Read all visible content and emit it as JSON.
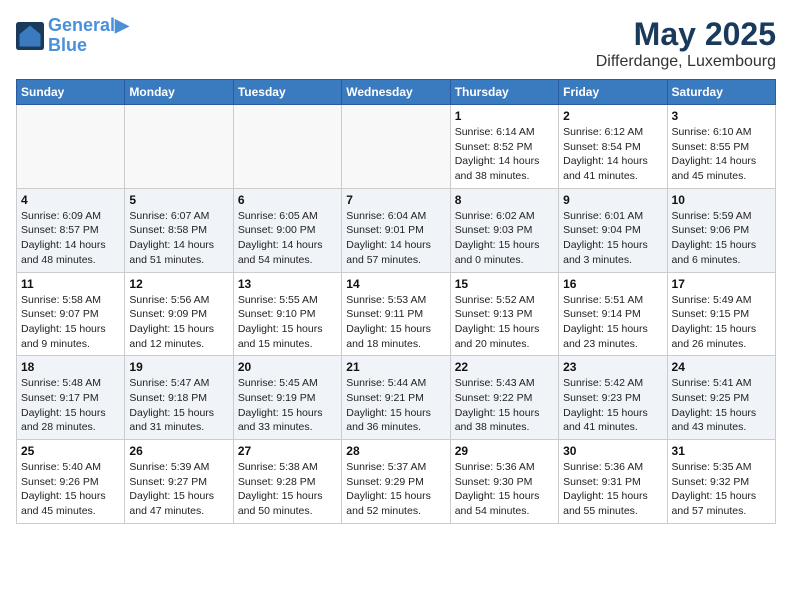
{
  "logo": {
    "line1": "General",
    "line2": "Blue"
  },
  "title": "May 2025",
  "subtitle": "Differdange, Luxembourg",
  "weekdays": [
    "Sunday",
    "Monday",
    "Tuesday",
    "Wednesday",
    "Thursday",
    "Friday",
    "Saturday"
  ],
  "weeks": [
    [
      {
        "day": "",
        "info": ""
      },
      {
        "day": "",
        "info": ""
      },
      {
        "day": "",
        "info": ""
      },
      {
        "day": "",
        "info": ""
      },
      {
        "day": "1",
        "info": "Sunrise: 6:14 AM\nSunset: 8:52 PM\nDaylight: 14 hours and 38 minutes."
      },
      {
        "day": "2",
        "info": "Sunrise: 6:12 AM\nSunset: 8:54 PM\nDaylight: 14 hours and 41 minutes."
      },
      {
        "day": "3",
        "info": "Sunrise: 6:10 AM\nSunset: 8:55 PM\nDaylight: 14 hours and 45 minutes."
      }
    ],
    [
      {
        "day": "4",
        "info": "Sunrise: 6:09 AM\nSunset: 8:57 PM\nDaylight: 14 hours and 48 minutes."
      },
      {
        "day": "5",
        "info": "Sunrise: 6:07 AM\nSunset: 8:58 PM\nDaylight: 14 hours and 51 minutes."
      },
      {
        "day": "6",
        "info": "Sunrise: 6:05 AM\nSunset: 9:00 PM\nDaylight: 14 hours and 54 minutes."
      },
      {
        "day": "7",
        "info": "Sunrise: 6:04 AM\nSunset: 9:01 PM\nDaylight: 14 hours and 57 minutes."
      },
      {
        "day": "8",
        "info": "Sunrise: 6:02 AM\nSunset: 9:03 PM\nDaylight: 15 hours and 0 minutes."
      },
      {
        "day": "9",
        "info": "Sunrise: 6:01 AM\nSunset: 9:04 PM\nDaylight: 15 hours and 3 minutes."
      },
      {
        "day": "10",
        "info": "Sunrise: 5:59 AM\nSunset: 9:06 PM\nDaylight: 15 hours and 6 minutes."
      }
    ],
    [
      {
        "day": "11",
        "info": "Sunrise: 5:58 AM\nSunset: 9:07 PM\nDaylight: 15 hours and 9 minutes."
      },
      {
        "day": "12",
        "info": "Sunrise: 5:56 AM\nSunset: 9:09 PM\nDaylight: 15 hours and 12 minutes."
      },
      {
        "day": "13",
        "info": "Sunrise: 5:55 AM\nSunset: 9:10 PM\nDaylight: 15 hours and 15 minutes."
      },
      {
        "day": "14",
        "info": "Sunrise: 5:53 AM\nSunset: 9:11 PM\nDaylight: 15 hours and 18 minutes."
      },
      {
        "day": "15",
        "info": "Sunrise: 5:52 AM\nSunset: 9:13 PM\nDaylight: 15 hours and 20 minutes."
      },
      {
        "day": "16",
        "info": "Sunrise: 5:51 AM\nSunset: 9:14 PM\nDaylight: 15 hours and 23 minutes."
      },
      {
        "day": "17",
        "info": "Sunrise: 5:49 AM\nSunset: 9:15 PM\nDaylight: 15 hours and 26 minutes."
      }
    ],
    [
      {
        "day": "18",
        "info": "Sunrise: 5:48 AM\nSunset: 9:17 PM\nDaylight: 15 hours and 28 minutes."
      },
      {
        "day": "19",
        "info": "Sunrise: 5:47 AM\nSunset: 9:18 PM\nDaylight: 15 hours and 31 minutes."
      },
      {
        "day": "20",
        "info": "Sunrise: 5:45 AM\nSunset: 9:19 PM\nDaylight: 15 hours and 33 minutes."
      },
      {
        "day": "21",
        "info": "Sunrise: 5:44 AM\nSunset: 9:21 PM\nDaylight: 15 hours and 36 minutes."
      },
      {
        "day": "22",
        "info": "Sunrise: 5:43 AM\nSunset: 9:22 PM\nDaylight: 15 hours and 38 minutes."
      },
      {
        "day": "23",
        "info": "Sunrise: 5:42 AM\nSunset: 9:23 PM\nDaylight: 15 hours and 41 minutes."
      },
      {
        "day": "24",
        "info": "Sunrise: 5:41 AM\nSunset: 9:25 PM\nDaylight: 15 hours and 43 minutes."
      }
    ],
    [
      {
        "day": "25",
        "info": "Sunrise: 5:40 AM\nSunset: 9:26 PM\nDaylight: 15 hours and 45 minutes."
      },
      {
        "day": "26",
        "info": "Sunrise: 5:39 AM\nSunset: 9:27 PM\nDaylight: 15 hours and 47 minutes."
      },
      {
        "day": "27",
        "info": "Sunrise: 5:38 AM\nSunset: 9:28 PM\nDaylight: 15 hours and 50 minutes."
      },
      {
        "day": "28",
        "info": "Sunrise: 5:37 AM\nSunset: 9:29 PM\nDaylight: 15 hours and 52 minutes."
      },
      {
        "day": "29",
        "info": "Sunrise: 5:36 AM\nSunset: 9:30 PM\nDaylight: 15 hours and 54 minutes."
      },
      {
        "day": "30",
        "info": "Sunrise: 5:36 AM\nSunset: 9:31 PM\nDaylight: 15 hours and 55 minutes."
      },
      {
        "day": "31",
        "info": "Sunrise: 5:35 AM\nSunset: 9:32 PM\nDaylight: 15 hours and 57 minutes."
      }
    ]
  ]
}
